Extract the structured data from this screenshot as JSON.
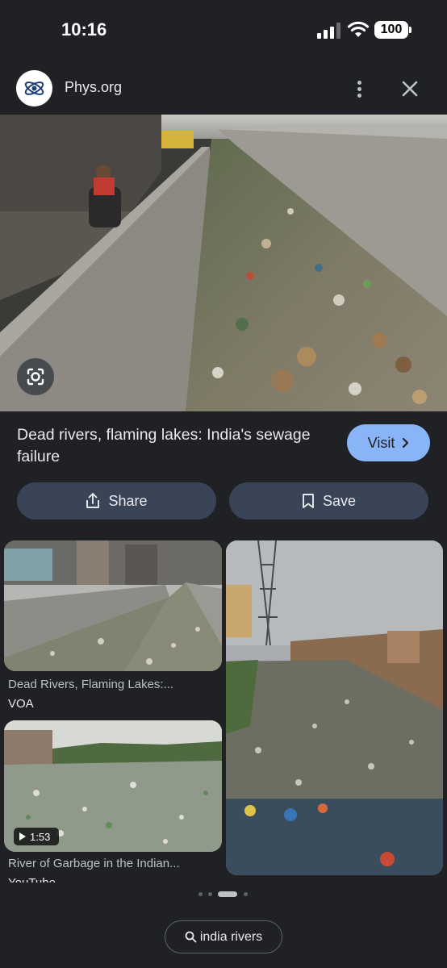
{
  "status_bar": {
    "time": "10:16",
    "battery": "100"
  },
  "source": {
    "name": "Phys.org"
  },
  "result": {
    "title": "Dead rivers, flaming lakes: India's sewage failure",
    "visit_label": "Visit"
  },
  "actions": {
    "share_label": "Share",
    "save_label": "Save"
  },
  "related": [
    {
      "caption": "Dead Rivers, Flaming Lakes:...",
      "source": "VOA"
    },
    {
      "caption": "",
      "source": ""
    },
    {
      "caption": "River of Garbage in the Indian...",
      "source": "YouTube",
      "duration": "1:53"
    }
  ],
  "query_chip": {
    "label": "india rivers"
  },
  "icons": {
    "lens": "google-lens-icon",
    "more": "more-vertical-icon",
    "close": "close-icon",
    "share": "share-icon",
    "save": "bookmark-icon",
    "search": "search-icon",
    "visit": "chevron-right-icon"
  },
  "colors": {
    "accent": "#8ab4f8",
    "pill_bg": "#394457",
    "page_bg": "#202124"
  }
}
